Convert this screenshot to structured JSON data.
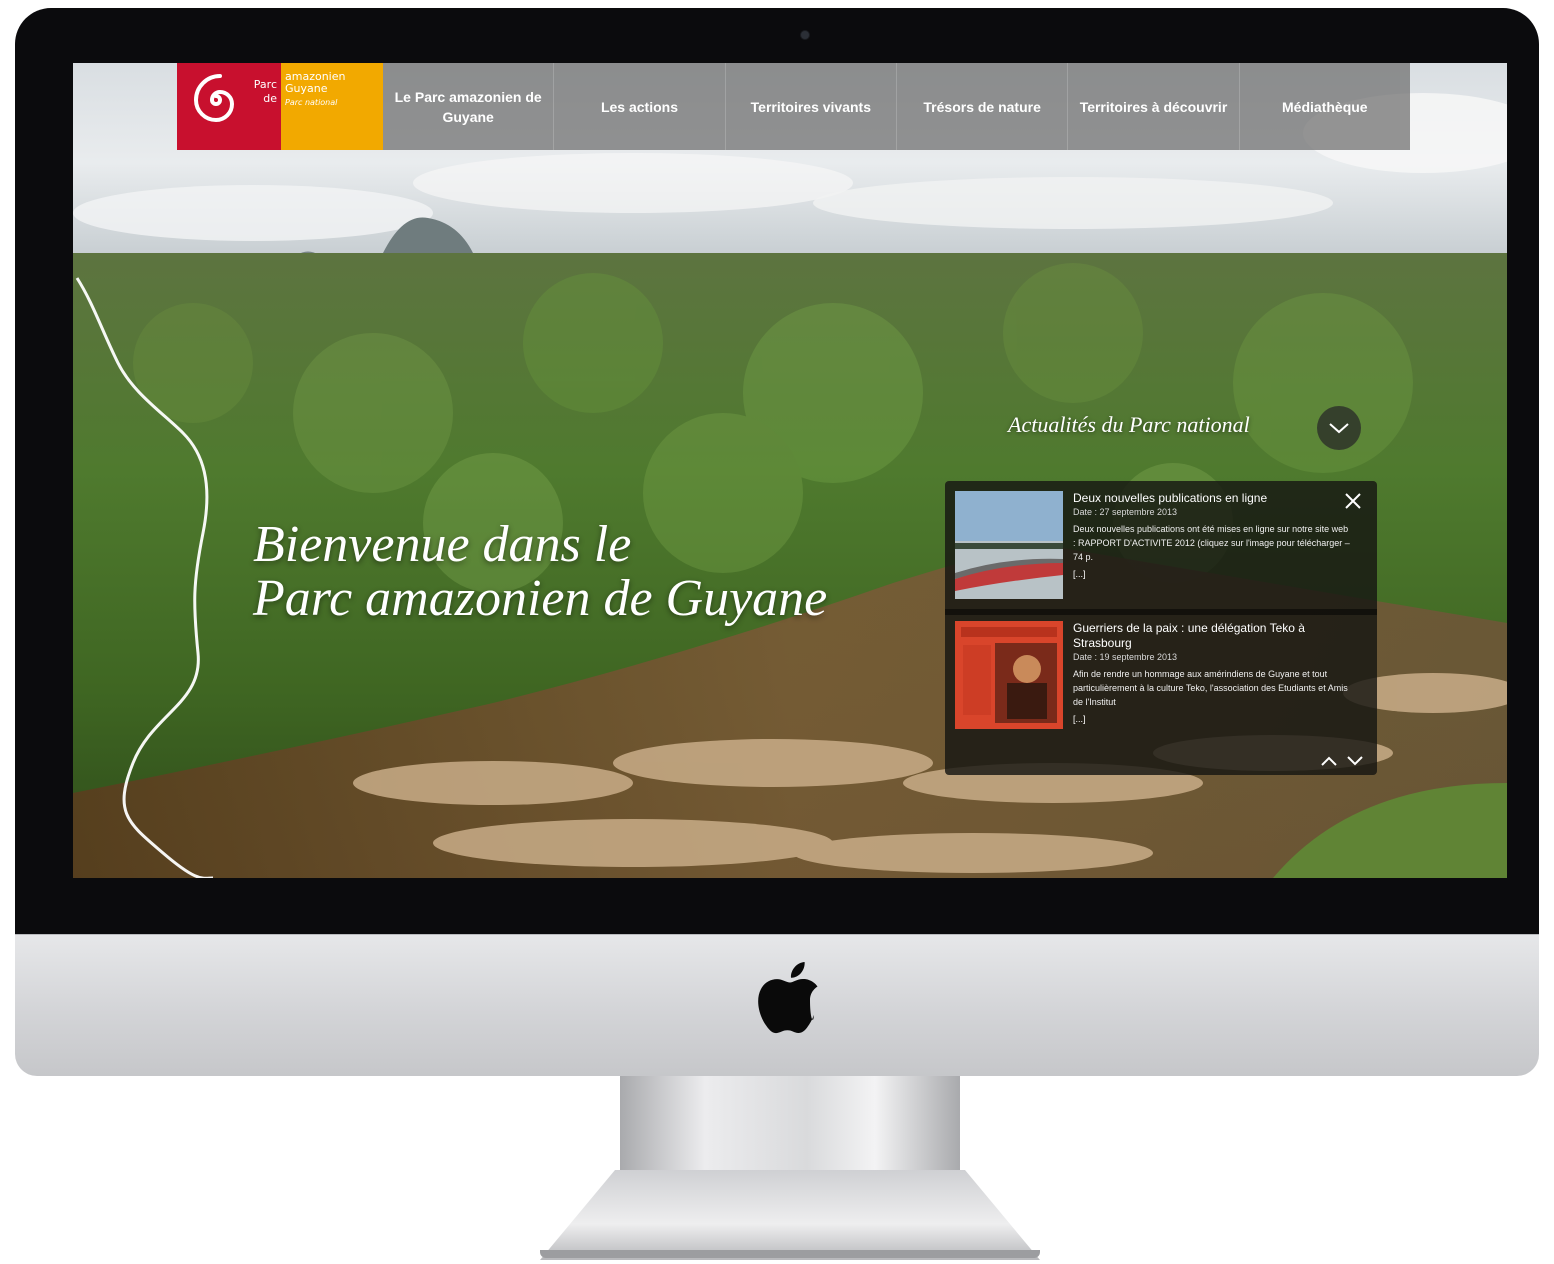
{
  "brand": {
    "logo_word_1": "Parc",
    "logo_word_2": "de",
    "logo_line_1": "amazonien",
    "logo_line_2": "Guyane",
    "logo_line_3": "Parc national",
    "red": "#c8102e",
    "yellow": "#f2a900"
  },
  "nav": {
    "items": [
      {
        "label": "Le Parc amazonien de Guyane"
      },
      {
        "label": "Les actions"
      },
      {
        "label": "Territoires vivants"
      },
      {
        "label": "Trésors de nature"
      },
      {
        "label": "Territoires à découvrir"
      },
      {
        "label": "Médiathèque"
      }
    ]
  },
  "hero": {
    "line_1": "Bienvenue dans le",
    "line_2": "Parc amazonien de Guyane"
  },
  "news": {
    "title": "Actualités du Parc national",
    "toggle_icon": "chevron-down-icon",
    "items": [
      {
        "headline": "Deux nouvelles publications en ligne",
        "date": "Date : 27 septembre 2013",
        "excerpt": "Deux nouvelles publications ont été mises en ligne sur notre site web : RAPPORT D'ACTIVITE 2012 (cliquez sur l'image pour télécharger – 74 p.",
        "more": "[...]"
      },
      {
        "headline": "Guerriers de la paix : une délégation Teko à Strasbourg",
        "date": "Date : 19 septembre 2013",
        "excerpt": "Afin de rendre un hommage aux amérindiens de Guyane et tout particulièrement à la culture Teko, l'association des Etudiants et Amis de l'Institut",
        "more": "[...]"
      }
    ]
  },
  "device": {
    "bezel_color": "#0b0b0d",
    "body_color": "#d3d4d7",
    "logo_icon": "apple-logo-icon"
  }
}
